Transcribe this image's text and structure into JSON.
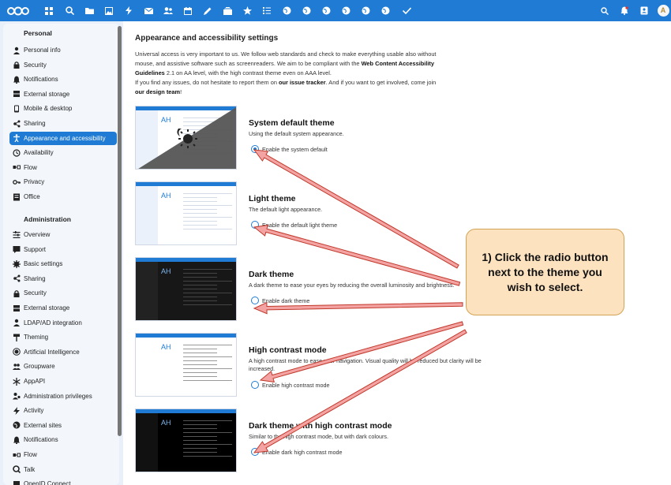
{
  "topbar": {
    "icons": [
      "nextcloud-logo-icon",
      "dashboard-icon",
      "search-icon",
      "files-icon",
      "photos-icon",
      "activity-icon",
      "mail-icon",
      "contacts-icon",
      "calendar-icon",
      "notes-icon",
      "deck-icon",
      "favorites-icon",
      "tasks-icon",
      "external-site-icon",
      "external-site-icon",
      "external-site-icon",
      "external-site-icon",
      "external-site-icon",
      "checkmark-icon"
    ],
    "user_initial": "A"
  },
  "sidebar": {
    "personal_heading": "Personal",
    "personal_items": [
      {
        "label": "Personal info",
        "icon": "person-icon"
      },
      {
        "label": "Security",
        "icon": "lock-icon"
      },
      {
        "label": "Notifications",
        "icon": "bell-icon"
      },
      {
        "label": "External storage",
        "icon": "storage-icon"
      },
      {
        "label": "Mobile & desktop",
        "icon": "phone-icon"
      },
      {
        "label": "Sharing",
        "icon": "share-icon"
      },
      {
        "label": "Appearance and accessibility",
        "icon": "accessibility-icon",
        "active": true
      },
      {
        "label": "Availability",
        "icon": "clock-icon"
      },
      {
        "label": "Flow",
        "icon": "flow-icon"
      },
      {
        "label": "Privacy",
        "icon": "key-icon"
      },
      {
        "label": "Office",
        "icon": "office-icon"
      }
    ],
    "admin_heading": "Administration",
    "admin_items": [
      {
        "label": "Overview",
        "icon": "overview-icon"
      },
      {
        "label": "Support",
        "icon": "support-icon"
      },
      {
        "label": "Basic settings",
        "icon": "gear-icon"
      },
      {
        "label": "Sharing",
        "icon": "share-icon"
      },
      {
        "label": "Security",
        "icon": "lock-icon"
      },
      {
        "label": "External storage",
        "icon": "storage-icon"
      },
      {
        "label": "LDAP/AD integration",
        "icon": "person-icon"
      },
      {
        "label": "Theming",
        "icon": "paint-icon"
      },
      {
        "label": "Artificial Intelligence",
        "icon": "ai-icon"
      },
      {
        "label": "Groupware",
        "icon": "group-icon"
      },
      {
        "label": "AppAPI",
        "icon": "app-api-icon"
      },
      {
        "label": "Administration privileges",
        "icon": "admin-icon"
      },
      {
        "label": "Activity",
        "icon": "activity-icon"
      },
      {
        "label": "External sites",
        "icon": "external-site-icon"
      },
      {
        "label": "Notifications",
        "icon": "bell-icon"
      },
      {
        "label": "Flow",
        "icon": "flow-icon"
      },
      {
        "label": "Talk",
        "icon": "talk-icon"
      },
      {
        "label": "OpenID Connect",
        "icon": "openid-icon"
      }
    ]
  },
  "main": {
    "title": "Appearance and accessibility settings",
    "intro": {
      "p1a": "Universal access is very important to us. We follow web standards and check to make everything usable also without mouse, and assistive software such as screenreaders. We aim to be compliant with the ",
      "p1link": "Web Content Accessibility Guidelines",
      "p1b": " 2.1 on AA level, with the high contrast theme even on AAA level.",
      "p2a": "If you find any issues, do not hesitate to report them on ",
      "p2link1": "our issue tracker",
      "p2b": ". And if you want to get involved, come join ",
      "p2link2": "our design team",
      "p2c": "!"
    },
    "themes": [
      {
        "title": "System default theme",
        "desc": "Using the default system appearance.",
        "radio_label": "Enable the system default",
        "checked": true
      },
      {
        "title": "Light theme",
        "desc": "The default light appearance.",
        "radio_label": "Enable the default light theme",
        "checked": false
      },
      {
        "title": "Dark theme",
        "desc": "A dark theme to ease your eyes by reducing the overall luminosity and brightness.",
        "radio_label": "Enable dark theme",
        "checked": false
      },
      {
        "title": "High contrast mode",
        "desc": "A high contrast mode to ease your navigation. Visual quality will be reduced but clarity will be increased.",
        "radio_label": "Enable high contrast mode",
        "checked": false
      },
      {
        "title": "Dark theme with high contrast mode",
        "desc": "Similar to the high contrast mode, but with dark colours.",
        "radio_label": "Enable dark high contrast mode",
        "checked": false
      }
    ],
    "thumb_avatar": "AH"
  },
  "callout": {
    "text": "1) Click the radio button next to the theme you wish to select."
  },
  "colors": {
    "accent": "#1f7bd3",
    "callout_bg": "#fde2c0",
    "arrow_fill": "#f4a3a3",
    "arrow_stroke": "#c0392b"
  }
}
